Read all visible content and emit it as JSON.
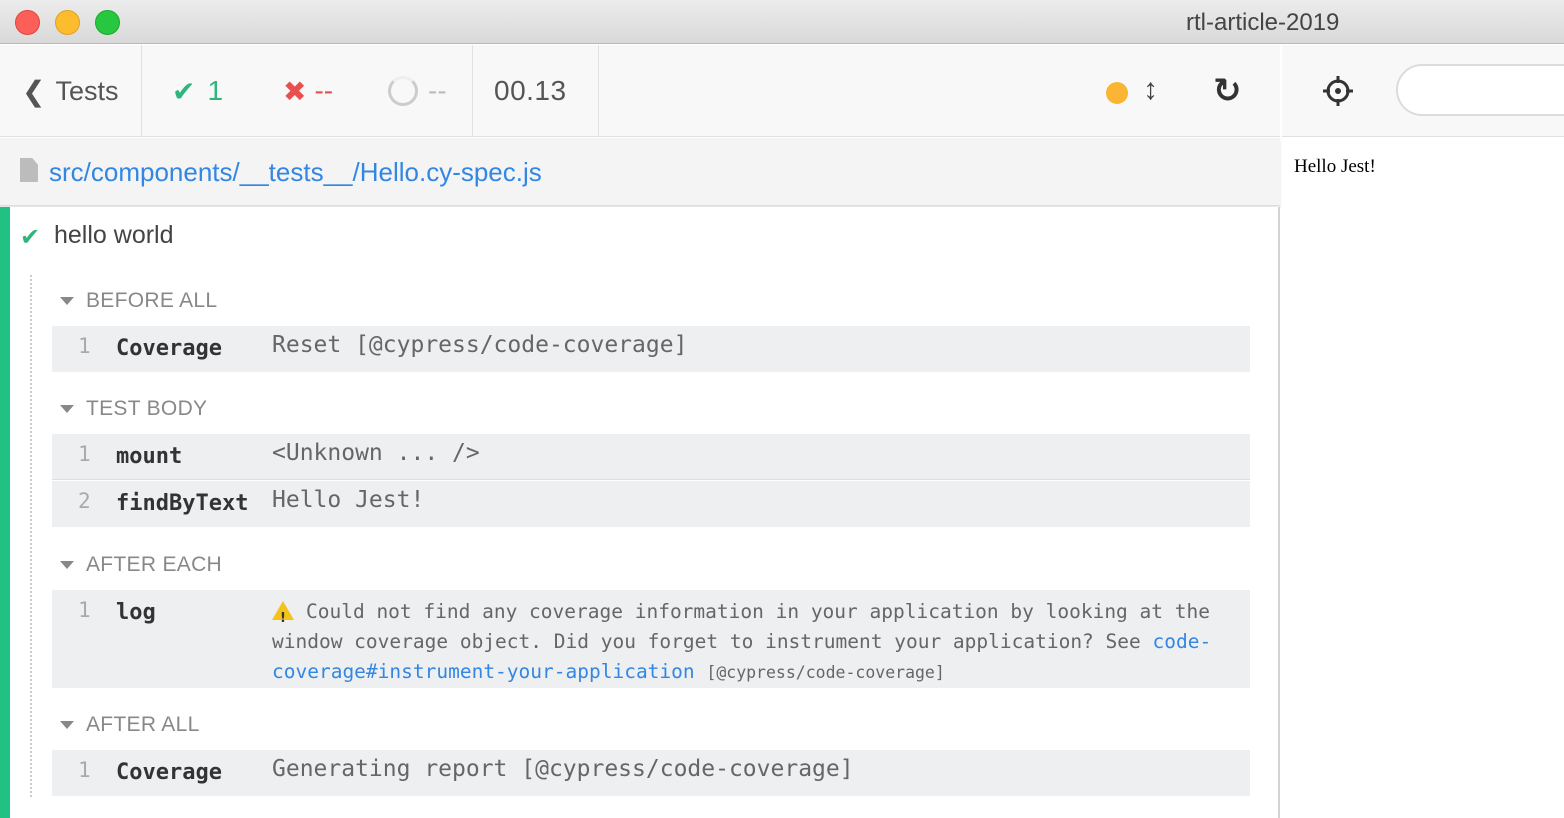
{
  "window": {
    "title": "rtl-article-2019"
  },
  "header": {
    "back_label": "Tests",
    "passed": "1",
    "failed": "--",
    "pending": "--",
    "duration": "00.13"
  },
  "spec": {
    "path": "src/components/__tests__/Hello.cy-spec.js"
  },
  "test": {
    "title": "hello world",
    "hooks": [
      {
        "title": "BEFORE ALL",
        "commands": [
          {
            "num": "1",
            "name": "Coverage",
            "message": "Reset [@cypress/code-coverage]"
          }
        ]
      },
      {
        "title": "TEST BODY",
        "commands": [
          {
            "num": "1",
            "name": "mount",
            "message": "<Unknown ... />"
          },
          {
            "num": "2",
            "name": "findByText",
            "message": "Hello Jest!"
          }
        ]
      },
      {
        "title": "AFTER EACH",
        "commands": [
          {
            "num": "1",
            "name": "log",
            "message": "Could not find any coverage information in your application by looking at the window coverage object. Did you forget to instrument your application? See",
            "link": "code-coverage#instrument-your-application",
            "tag": "[@cypress/code-coverage]"
          }
        ]
      },
      {
        "title": "AFTER ALL",
        "commands": [
          {
            "num": "1",
            "name": "Coverage",
            "message": "Generating report [@cypress/code-coverage]"
          }
        ]
      }
    ]
  },
  "preview": {
    "content": "Hello Jest!",
    "url_value": ""
  },
  "colors": {
    "pass": "#21c183",
    "fail": "#e94f4f",
    "link": "#3486e3",
    "running": "#f9b533"
  },
  "icons": [
    "chevron-left-icon",
    "check-icon",
    "x-icon",
    "spinner-icon",
    "resize-icon",
    "reload-icon",
    "file-icon",
    "warning-icon",
    "crosshair-icon"
  ]
}
